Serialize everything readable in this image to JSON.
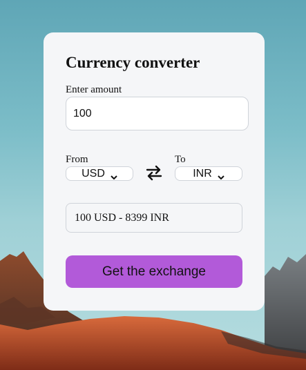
{
  "converter": {
    "title": "Currency converter",
    "amount_label": "Enter amount",
    "amount_value": "100",
    "from_label": "From",
    "from_currency": "USD",
    "to_label": "To",
    "to_currency": "INR",
    "result_text": "100 USD - 8399 INR",
    "button_label": "Get the exchange"
  },
  "colors": {
    "button": "#b25ad9",
    "card": "#f5f6f8",
    "sky": "#7cbdc8",
    "mountain": "#c25a33"
  },
  "icons": {
    "swap": "swap-arrows-icon",
    "chevron": "chevron-down-icon"
  }
}
